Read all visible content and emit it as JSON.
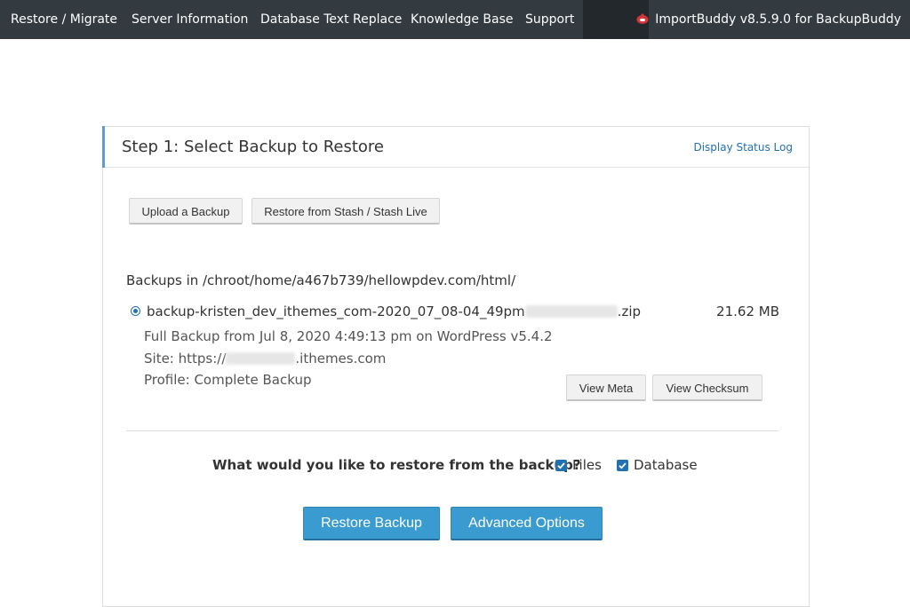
{
  "nav": {
    "items": [
      {
        "label": "Restore / Migrate"
      },
      {
        "label": "Server Information"
      },
      {
        "label": "Database Text Replace"
      },
      {
        "label": "Knowledge Base"
      },
      {
        "label": "Support"
      }
    ],
    "brand": "ImportBuddy v8.5.9.0 for BackupBuddy",
    "brand_icon": "importbuddy-logo-icon"
  },
  "step": {
    "title": "Step 1: Select Backup to Restore",
    "status_link": "Display Status Log"
  },
  "buttons": {
    "upload": "Upload a Backup",
    "stash": "Restore from Stash / Stash Live",
    "view_meta": "View Meta",
    "view_checksum": "View Checksum",
    "restore": "Restore Backup",
    "advanced": "Advanced Options"
  },
  "backups": {
    "path_label": "Backups in /chroot/home/a467b739/hellowpdev.com/html/",
    "item": {
      "name_prefix": "backup-kristen_dev_ithemes_com-2020_07_08-04_49pm",
      "name_suffix": ".zip",
      "size": "21.62 MB",
      "details": "Full Backup from Jul 8, 2020 4:49:13 pm on WordPress v5.4.2",
      "site_prefix": "Site: https://",
      "site_suffix": ".ithemes.com",
      "profile": "Profile: Complete Backup",
      "selected": true
    }
  },
  "restore": {
    "question": "What would you like to restore from the backup?",
    "options": [
      {
        "label": "Files",
        "checked": true
      },
      {
        "label": "Database",
        "checked": true
      }
    ]
  },
  "colors": {
    "accent": "#2271b1",
    "primary_button": "#3a9bd1",
    "topbar": "#333a40"
  }
}
